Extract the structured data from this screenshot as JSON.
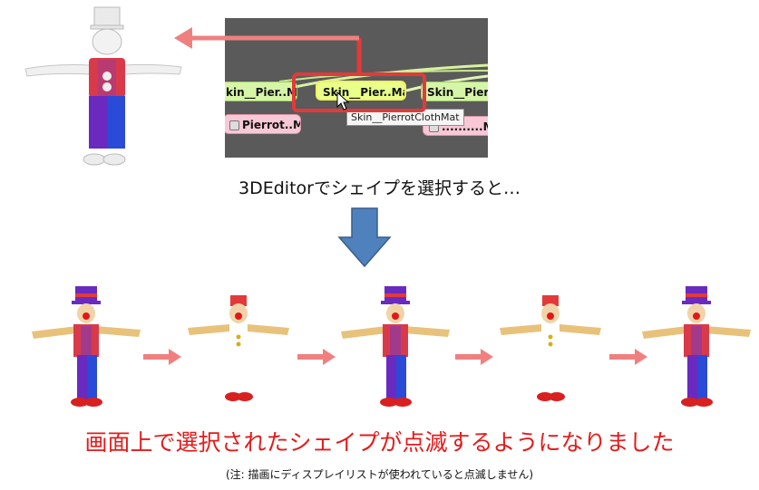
{
  "editor": {
    "nodes": [
      {
        "label": "kin__Pier..Mat",
        "kind": "green"
      },
      {
        "label": "Skin__Pier..Mat",
        "kind": "selected"
      },
      {
        "label": "Skin__Pier..M",
        "kind": "green"
      },
      {
        "label": "Pierrot..Mat",
        "kind": "pink"
      },
      {
        "label": "..........M",
        "kind": "pink"
      }
    ],
    "tooltip": "Skin__PierrotClothMat"
  },
  "captions": {
    "select_shape": "3DEditorでシェイプを選択すると…",
    "result": "画面上で選択されたシェイプが点滅するようになりました",
    "note": "(注: 描画にディスプレイリストが使われていると点滅しません)"
  },
  "colors": {
    "highlight_red": "#e23a3a",
    "arrow_salmon": "#f08080",
    "down_arrow_blue": "#4f81bd",
    "result_text": "#e41b1b"
  },
  "icons": {
    "big_arrow_left": "arrow-left-icon",
    "down_arrow": "arrow-down-icon",
    "small_arrows": "arrow-right-icon",
    "cursor": "mouse-cursor-icon"
  },
  "frames": [
    "full-character",
    "head-and-feet-only",
    "full-character",
    "head-and-feet-only",
    "full-character"
  ]
}
